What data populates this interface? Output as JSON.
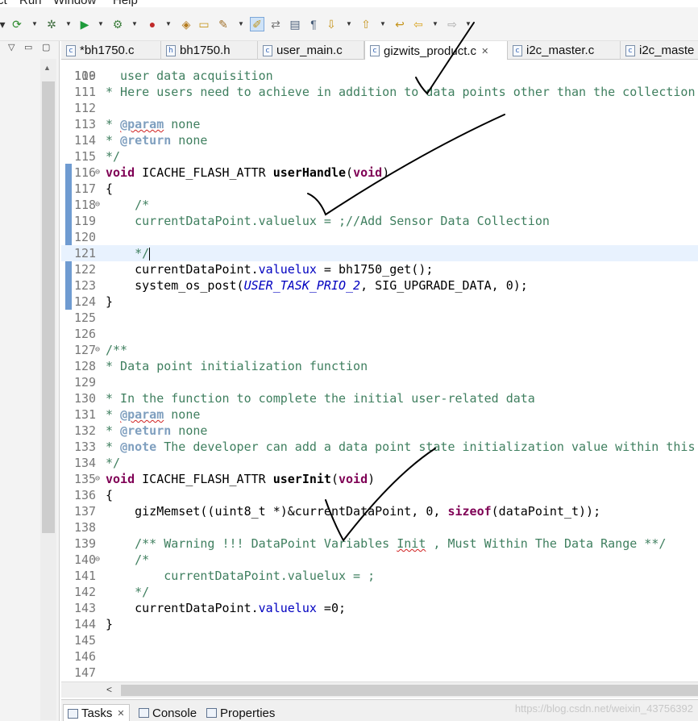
{
  "menu": [
    "ct",
    "Run",
    "Window",
    "Help"
  ],
  "tabs": [
    {
      "label": "*bh1750.c",
      "active": false
    },
    {
      "label": "bh1750.h",
      "active": false
    },
    {
      "label": "user_main.c",
      "active": false
    },
    {
      "label": "gizwits_product.c",
      "active": true
    },
    {
      "label": "i2c_master.c",
      "active": false
    },
    {
      "label": "i2c_maste",
      "active": false
    }
  ],
  "editor": {
    "top_partial": "user data acquisition",
    "lines": [
      {
        "n": "110",
        "text": ""
      },
      {
        "n": "111",
        "text": "* Here users need to achieve in addition to data points other than the collection"
      },
      {
        "n": "112",
        "text": ""
      },
      {
        "n": "113",
        "text": "* @param none"
      },
      {
        "n": "114",
        "text": "* @return none"
      },
      {
        "n": "115",
        "text": "*/"
      },
      {
        "n": "116",
        "text": "void ICACHE_FLASH_ATTR userHandle(void)"
      },
      {
        "n": "117",
        "text": "{"
      },
      {
        "n": "118",
        "text": "    /*"
      },
      {
        "n": "119",
        "text": "    currentDataPoint.valuelux = ;//Add Sensor Data Collection"
      },
      {
        "n": "120",
        "text": ""
      },
      {
        "n": "121",
        "text": "    */"
      },
      {
        "n": "122",
        "text": "    currentDataPoint.valuelux = bh1750_get();"
      },
      {
        "n": "123",
        "text": "    system_os_post(USER_TASK_PRIO_2, SIG_UPGRADE_DATA, 0);"
      },
      {
        "n": "124",
        "text": "}"
      },
      {
        "n": "125",
        "text": ""
      },
      {
        "n": "126",
        "text": ""
      },
      {
        "n": "127",
        "text": "/**"
      },
      {
        "n": "128",
        "text": "* Data point initialization function"
      },
      {
        "n": "129",
        "text": ""
      },
      {
        "n": "130",
        "text": "* In the function to complete the initial user-related data"
      },
      {
        "n": "131",
        "text": "* @param none"
      },
      {
        "n": "132",
        "text": "* @return none"
      },
      {
        "n": "133",
        "text": "* @note The developer can add a data point state initialization value within this"
      },
      {
        "n": "134",
        "text": "*/"
      },
      {
        "n": "135",
        "text": "void ICACHE_FLASH_ATTR userInit(void)"
      },
      {
        "n": "136",
        "text": "{"
      },
      {
        "n": "137",
        "text": "    gizMemset((uint8_t *)&currentDataPoint, 0, sizeof(dataPoint_t));"
      },
      {
        "n": "138",
        "text": ""
      },
      {
        "n": "139",
        "text": "    /** Warning !!! DataPoint Variables Init , Must Within The Data Range **/"
      },
      {
        "n": "140",
        "text": "    /*"
      },
      {
        "n": "141",
        "text": "        currentDataPoint.valuelux = ;"
      },
      {
        "n": "142",
        "text": "    */"
      },
      {
        "n": "143",
        "text": "    currentDataPoint.valuelux =0;"
      },
      {
        "n": "144",
        "text": "}"
      },
      {
        "n": "145",
        "text": ""
      },
      {
        "n": "146",
        "text": ""
      },
      {
        "n": "147",
        "text": ""
      }
    ]
  },
  "bottom_tabs": [
    {
      "label": "Tasks",
      "active": true
    },
    {
      "label": "Console",
      "active": false
    },
    {
      "label": "Properties",
      "active": false
    }
  ],
  "watermark": "https://blog.csdn.net/weixin_43756392",
  "icons": [
    "new-icon",
    "build-icon",
    "debug-icon",
    "run-icon",
    "external-tools-icon",
    "open-type-icon",
    "open-folder-icon",
    "pen-icon",
    "mark-occurrences-icon",
    "show-whitespace-icon",
    "block-select-icon",
    "paragraph-icon",
    "next-annotation-icon",
    "prev-annotation-icon",
    "last-edit-icon",
    "back-icon",
    "forward-icon"
  ]
}
